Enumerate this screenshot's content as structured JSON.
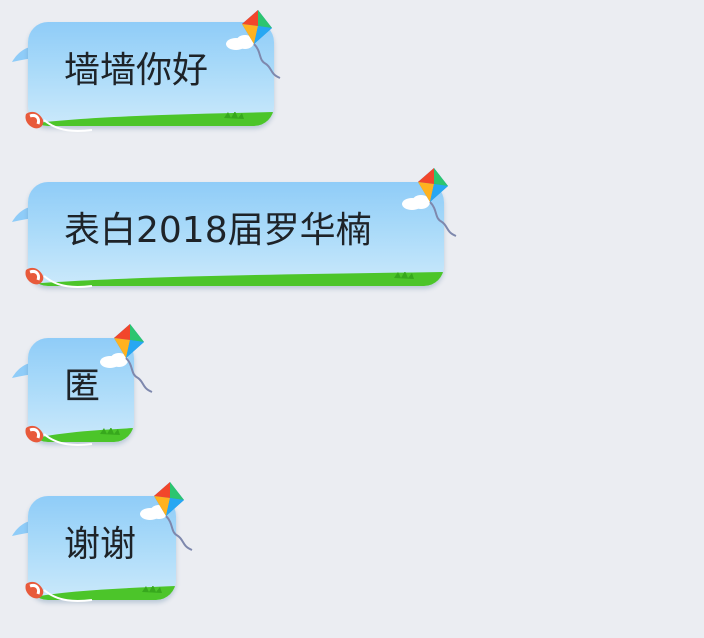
{
  "messages": [
    {
      "text": "墙墙你好"
    },
    {
      "text": "表白2018届罗华楠"
    },
    {
      "text": "匿"
    },
    {
      "text": "谢谢"
    }
  ],
  "colors": {
    "background": "#ebedf2",
    "bubble_top": "#8fccf8",
    "bubble_bottom": "#cbe9fb",
    "grass": "#4cc52a",
    "text": "#1e2328"
  },
  "icons": [
    "kite-icon",
    "cloud-icon",
    "sneaker-icon",
    "grass-decoration"
  ]
}
